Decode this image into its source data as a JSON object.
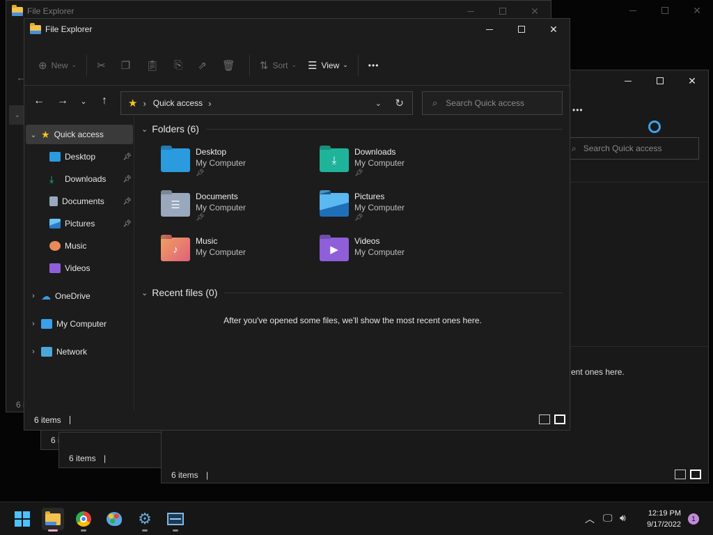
{
  "window_title": "File Explorer",
  "toolbar": {
    "new_label": "New",
    "sort_label": "Sort",
    "view_label": "View",
    "more_glyph": "•••"
  },
  "address": {
    "location": "Quick access",
    "search_placeholder": "Search Quick access"
  },
  "sidebar": {
    "items": [
      {
        "label": "Quick access",
        "icon": "star-icon"
      },
      {
        "label": "Desktop",
        "icon": "desktop-icon"
      },
      {
        "label": "Downloads",
        "icon": "download-icon"
      },
      {
        "label": "Documents",
        "icon": "document-icon"
      },
      {
        "label": "Pictures",
        "icon": "picture-icon"
      },
      {
        "label": "Music",
        "icon": "music-icon"
      },
      {
        "label": "Videos",
        "icon": "video-icon"
      },
      {
        "label": "OneDrive",
        "icon": "cloud-icon"
      },
      {
        "label": "My Computer",
        "icon": "computer-icon"
      },
      {
        "label": "Network",
        "icon": "network-icon"
      }
    ]
  },
  "folders_section": {
    "title": "Folders (6)",
    "folders": [
      {
        "name": "Desktop",
        "location": "My Computer",
        "color": "#2b9be0"
      },
      {
        "name": "Downloads",
        "location": "My Computer",
        "color": "#1fb39a"
      },
      {
        "name": "Documents",
        "location": "My Computer",
        "color": "#9aa8bd"
      },
      {
        "name": "Pictures",
        "location": "My Computer",
        "color": "#3a9ae0"
      },
      {
        "name": "Music",
        "location": "My Computer",
        "color": "#e98a5a"
      },
      {
        "name": "Videos",
        "location": "My Computer",
        "color": "#8e5fd8"
      }
    ]
  },
  "recent_section": {
    "title": "Recent files (0)",
    "empty_message": "After you've opened some files, we'll show the most recent ones here."
  },
  "status": {
    "count": "6 items"
  },
  "background_windows": {
    "title": "File Explorer",
    "status_count": "6 items",
    "search_placeholder": "Search Quick access",
    "truncated_message": "ent ones here.",
    "more_glyph": "•••",
    "partial_count": "6 i"
  },
  "taskbar": {
    "time": "12:19 PM",
    "date": "9/17/2022",
    "notification_count": "1"
  },
  "colors": {
    "accent": "#4cc2ff",
    "star": "#f5c518",
    "window_bg": "#1c1c1c"
  }
}
